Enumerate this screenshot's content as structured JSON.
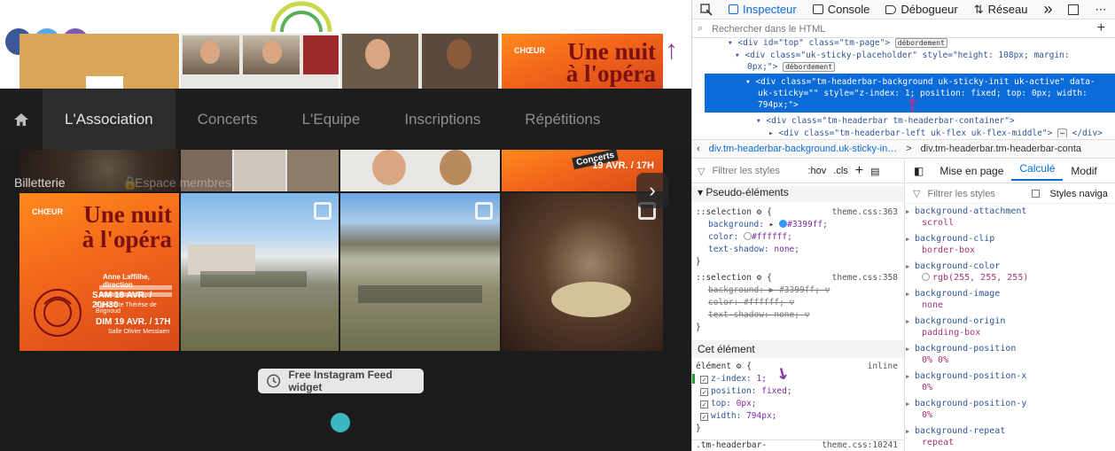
{
  "site": {
    "nav": {
      "items": [
        {
          "label": "L'Association",
          "active": true
        },
        {
          "label": "Concerts",
          "active": false
        },
        {
          "label": "L'Equipe",
          "active": false
        },
        {
          "label": "Inscriptions",
          "active": false
        },
        {
          "label": "Répétitions",
          "active": false
        }
      ]
    },
    "subnav": {
      "billetterie": "Billetterie",
      "espace_membres": "Espace membres"
    },
    "poster": {
      "title_line1": "Une nuit",
      "title_line2": "à l'opéra",
      "brand": "CHŒUR",
      "director": "Anne Laffilhe, direction",
      "date1": "SAM 18 AVR. / 20H30",
      "venue1": "Eglise Ste Thérèse de Brignoud",
      "date2": "DIM 19 AVR. / 17H",
      "venue2": "Salle Olivier Messiaen",
      "concerts_badge": "Concerts",
      "right_date": "19 AVR. / 17H"
    },
    "instagram_button": "Free Instagram Feed widget",
    "carousel_arrow": "›"
  },
  "devtools": {
    "tabs": [
      "Inspecteur",
      "Console",
      "Débogueur",
      "Réseau"
    ],
    "more": "»",
    "search_placeholder": "Rechercher dans le HTML",
    "tree": {
      "line1": "<div id=\"top\" class=\"tm-page\">",
      "line1_badge": "débordement",
      "line2": "<div class=\"uk-sticky-placeholder\" style=\"height: 108px; margin:",
      "line3": "0px;\">",
      "line3_badge": "débordement",
      "sel1": "<div class=\"tm-headerbar-background uk-sticky-init uk-active\" data-",
      "sel2": "uk-sticky=\"\" style=\"z-index: 1; position: fixed; top: 0px; width:",
      "sel3": "794px;\">",
      "line4": "<div class=\"tm-headerbar tm-headerbar-container\">",
      "line5": "<div class=\"tm-headerbar-left uk-flex uk-flex-middle\">",
      "line5_end": "</div>"
    },
    "breadcrumb": {
      "item1": "div.tm-headerbar-background.uk-sticky-in…",
      "separator": ">",
      "item2": "div.tm-headerbar.tm-headerbar-conta"
    },
    "rules": {
      "filter_placeholder": "Filtrer les styles",
      "hov": ":hov",
      "cls": ".cls",
      "pseudo_header": "Pseudo-éléments",
      "sel1": "::selection",
      "file1": "theme.css:363",
      "p1": "background:",
      "v1": "#3399ff;",
      "p2": "color:",
      "v2": "#ffffff;",
      "p3": "text-shadow:",
      "v3": "none;",
      "file2": "theme.css:358",
      "sp1": "background: ▶ #3399ff;",
      "sp2": "color: #ffffff;",
      "sp3": "text-shadow: none;",
      "this_element": "Cet élément",
      "element_sel": "élément",
      "inline": "inline",
      "e1p": "z-index:",
      "e1v": "1;",
      "e2p": "position:",
      "e2v": "fixed;",
      "e3p": "top:",
      "e3v": "0px;",
      "e4p": "width:",
      "e4v": "794px;",
      "next_sel": ".tm-headerbar-",
      "next_file": "theme.css:10241"
    },
    "computed": {
      "tabs": [
        "Mise en page",
        "Calculé",
        "Modif"
      ],
      "filter_placeholder": "Filtrer les styles",
      "browser_styles": "Styles naviga",
      "props": [
        {
          "name": "background-attachment",
          "value": "scroll"
        },
        {
          "name": "background-clip",
          "value": "border-box"
        },
        {
          "name": "background-color",
          "value": "rgb(255, 255, 255)"
        },
        {
          "name": "background-image",
          "value": "none"
        },
        {
          "name": "background-origin",
          "value": "padding-box"
        },
        {
          "name": "background-position",
          "value": "0% 0%"
        },
        {
          "name": "background-position-x",
          "value": "0%"
        },
        {
          "name": "background-position-y",
          "value": "0%"
        },
        {
          "name": "background-repeat",
          "value": "repeat"
        }
      ]
    }
  },
  "colors": {
    "accent": "#0a6bd9",
    "nav_bg": "#1d1d1d",
    "dot": "#3ab7c1",
    "annotation": "#8e3fa7"
  }
}
